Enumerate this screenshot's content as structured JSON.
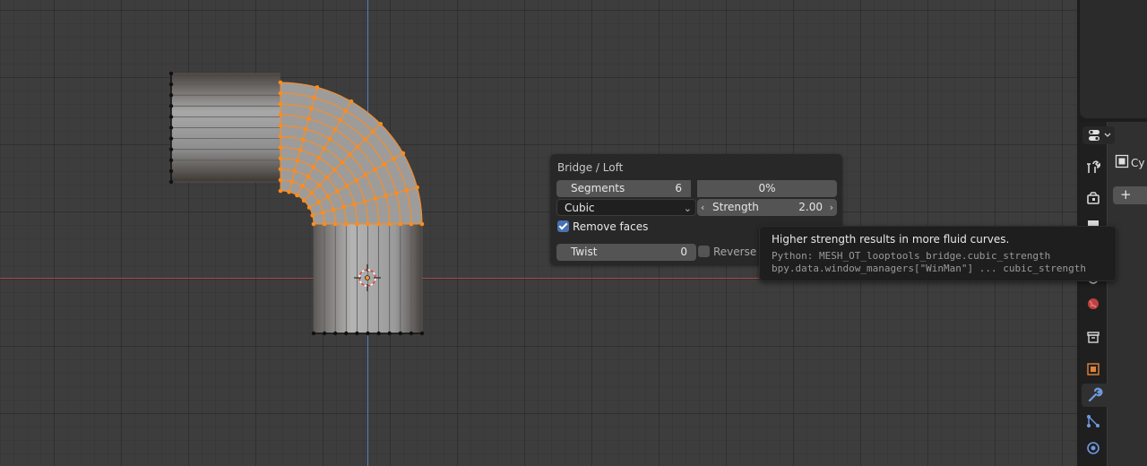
{
  "redo_panel": {
    "title": "Bridge / Loft",
    "segments_label": "Segments",
    "segments_value": "6",
    "minimum_width": "0%",
    "interpolation": "Cubic",
    "strength_label": "Strength",
    "strength_value": "2.00",
    "remove_faces_label": "Remove faces",
    "remove_faces_checked": true,
    "twist_label": "Twist",
    "twist_value": "0",
    "reverse_label": "Reverse",
    "reverse_checked": false
  },
  "tooltip": {
    "description": "Higher strength results in more fluid curves.",
    "python_line1": "Python: MESH_OT_looptools_bridge.cubic_strength",
    "python_line2": "bpy.data.window_managers[\"WinMan\"] ... cubic_strength"
  },
  "properties": {
    "object_name_partial": "Cy",
    "add_button": "+",
    "tabs": [
      "tool-icon",
      "render-icon",
      "output-icon",
      "view-layer-icon",
      "world-icon",
      "collection-icon",
      "object-icon",
      "modifier-icon",
      "particles-icon",
      "physics-icon"
    ]
  },
  "colors": {
    "selected_vertex": "#ff8c1a",
    "axis_x": "#b0474c",
    "axis_y": "#5b79c7",
    "accent": "#4772b3"
  }
}
